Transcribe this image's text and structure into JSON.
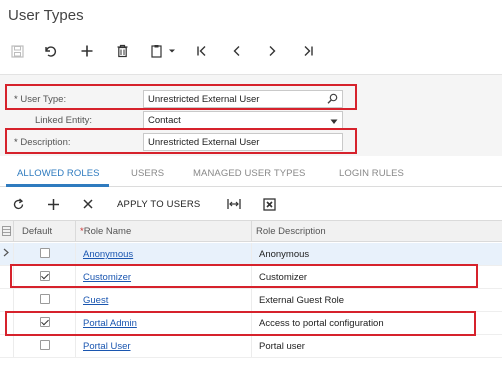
{
  "page": {
    "title": "User Types"
  },
  "toolbar": {
    "icons": [
      "save-icon",
      "undo-icon",
      "add-icon",
      "delete-icon",
      "copy-paste-icon",
      "first-record-icon",
      "previous-record-icon",
      "next-record-icon",
      "last-record-icon"
    ]
  },
  "form": {
    "user_type": {
      "required_mark": "*",
      "label": "User Type:",
      "value": "Unrestricted External User"
    },
    "linked_entity": {
      "label": "Linked Entity:",
      "value": "Contact"
    },
    "description": {
      "required_mark": "*",
      "label": "Description:",
      "value": "Unrestricted External User"
    }
  },
  "tabs": [
    {
      "label": "ALLOWED ROLES",
      "active": true
    },
    {
      "label": "USERS",
      "active": false
    },
    {
      "label": "MANAGED USER TYPES",
      "active": false
    },
    {
      "label": "LOGIN RULES",
      "active": false
    }
  ],
  "grid_toolbar": {
    "apply_label": "APPLY TO USERS"
  },
  "grid": {
    "columns": {
      "default": "Default",
      "role_name_required": "*",
      "role_name": "Role Name",
      "role_description": "Role Description"
    },
    "rows": [
      {
        "default": false,
        "role_name": "Anonymous",
        "role_description": "Anonymous",
        "selected": true
      },
      {
        "default": true,
        "role_name": "Customizer",
        "role_description": "Customizer",
        "selected": false
      },
      {
        "default": false,
        "role_name": "Guest",
        "role_description": "External Guest Role",
        "selected": false
      },
      {
        "default": true,
        "role_name": "Portal Admin",
        "role_description": "Access to portal configuration",
        "selected": false
      },
      {
        "default": false,
        "role_name": "Portal User",
        "role_description": "Portal user",
        "selected": false
      }
    ]
  },
  "colors": {
    "accent": "#2f7bbf",
    "highlight": "#d6222c",
    "link": "#1a56b0",
    "selected_row": "#e8f1fb"
  }
}
